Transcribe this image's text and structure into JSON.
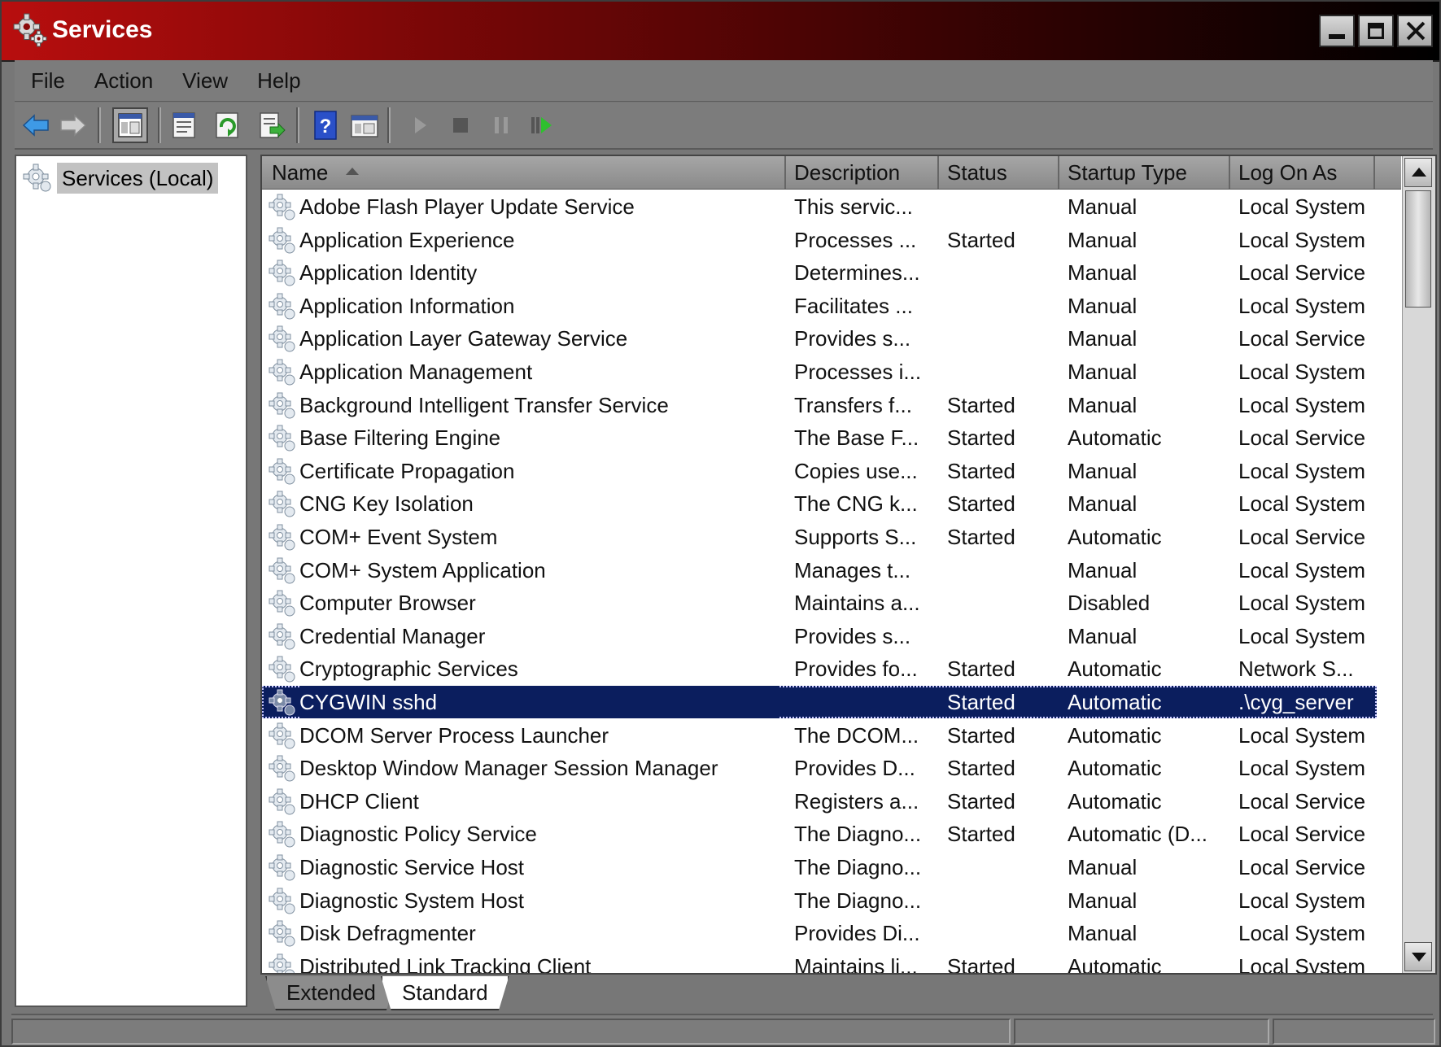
{
  "window": {
    "title": "Services",
    "title_bar_colors": [
      "#b80e0e",
      "#000000"
    ]
  },
  "menu": {
    "items": [
      {
        "label": "File"
      },
      {
        "label": "Action"
      },
      {
        "label": "View"
      },
      {
        "label": "Help"
      }
    ]
  },
  "toolbar": {
    "icons": [
      "back-arrow-icon",
      "forward-arrow-icon",
      "show-hide-console-tree-icon",
      "properties-icon",
      "refresh-icon",
      "export-list-icon",
      "help-icon",
      "view-icon",
      "start-service-icon",
      "stop-service-icon",
      "pause-service-icon",
      "restart-service-icon"
    ]
  },
  "tree": {
    "root_label": "Services (Local)"
  },
  "list": {
    "columns": [
      {
        "key": "name",
        "label": "Name"
      },
      {
        "key": "description",
        "label": "Description"
      },
      {
        "key": "status",
        "label": "Status"
      },
      {
        "key": "startup",
        "label": "Startup Type"
      },
      {
        "key": "logon",
        "label": "Log On As"
      }
    ],
    "sort_column": "name",
    "selected_color": "#0b1e5e",
    "rows": [
      {
        "name": "Adobe Flash Player Update Service",
        "description": "This servic...",
        "status": "",
        "startup": "Manual",
        "logon": "Local System"
      },
      {
        "name": "Application Experience",
        "description": "Processes ...",
        "status": "Started",
        "startup": "Manual",
        "logon": "Local System"
      },
      {
        "name": "Application Identity",
        "description": "Determines...",
        "status": "",
        "startup": "Manual",
        "logon": "Local Service"
      },
      {
        "name": "Application Information",
        "description": "Facilitates ...",
        "status": "",
        "startup": "Manual",
        "logon": "Local System"
      },
      {
        "name": "Application Layer Gateway Service",
        "description": "Provides s...",
        "status": "",
        "startup": "Manual",
        "logon": "Local Service"
      },
      {
        "name": "Application Management",
        "description": "Processes i...",
        "status": "",
        "startup": "Manual",
        "logon": "Local System"
      },
      {
        "name": "Background Intelligent Transfer Service",
        "description": "Transfers f...",
        "status": "Started",
        "startup": "Manual",
        "logon": "Local System"
      },
      {
        "name": "Base Filtering Engine",
        "description": "The Base F...",
        "status": "Started",
        "startup": "Automatic",
        "logon": "Local Service"
      },
      {
        "name": "Certificate Propagation",
        "description": "Copies use...",
        "status": "Started",
        "startup": "Manual",
        "logon": "Local System"
      },
      {
        "name": "CNG Key Isolation",
        "description": "The CNG k...",
        "status": "Started",
        "startup": "Manual",
        "logon": "Local System"
      },
      {
        "name": "COM+ Event System",
        "description": "Supports S...",
        "status": "Started",
        "startup": "Automatic",
        "logon": "Local Service"
      },
      {
        "name": "COM+ System Application",
        "description": "Manages t...",
        "status": "",
        "startup": "Manual",
        "logon": "Local System"
      },
      {
        "name": "Computer Browser",
        "description": "Maintains a...",
        "status": "",
        "startup": "Disabled",
        "logon": "Local System"
      },
      {
        "name": "Credential Manager",
        "description": "Provides s...",
        "status": "",
        "startup": "Manual",
        "logon": "Local System"
      },
      {
        "name": "Cryptographic Services",
        "description": "Provides fo...",
        "status": "Started",
        "startup": "Automatic",
        "logon": "Network S..."
      },
      {
        "name": "CYGWIN sshd",
        "description": "",
        "status": "Started",
        "startup": "Automatic",
        "logon": ".\\cyg_server",
        "selected": true
      },
      {
        "name": "DCOM Server Process Launcher",
        "description": "The DCOM...",
        "status": "Started",
        "startup": "Automatic",
        "logon": "Local System"
      },
      {
        "name": "Desktop Window Manager Session Manager",
        "description": "Provides D...",
        "status": "Started",
        "startup": "Automatic",
        "logon": "Local System"
      },
      {
        "name": "DHCP Client",
        "description": "Registers a...",
        "status": "Started",
        "startup": "Automatic",
        "logon": "Local Service"
      },
      {
        "name": "Diagnostic Policy Service",
        "description": "The Diagno...",
        "status": "Started",
        "startup": "Automatic (D...",
        "logon": "Local Service"
      },
      {
        "name": "Diagnostic Service Host",
        "description": "The Diagno...",
        "status": "",
        "startup": "Manual",
        "logon": "Local Service"
      },
      {
        "name": "Diagnostic System Host",
        "description": "The Diagno...",
        "status": "",
        "startup": "Manual",
        "logon": "Local System"
      },
      {
        "name": "Disk Defragmenter",
        "description": "Provides Di...",
        "status": "",
        "startup": "Manual",
        "logon": "Local System"
      },
      {
        "name": "Distributed Link Tracking Client",
        "description": "Maintains li...",
        "status": "Started",
        "startup": "Automatic",
        "logon": "Local System"
      }
    ]
  },
  "tabs": [
    {
      "label": "Extended",
      "active": false
    },
    {
      "label": "Standard",
      "active": true
    }
  ]
}
